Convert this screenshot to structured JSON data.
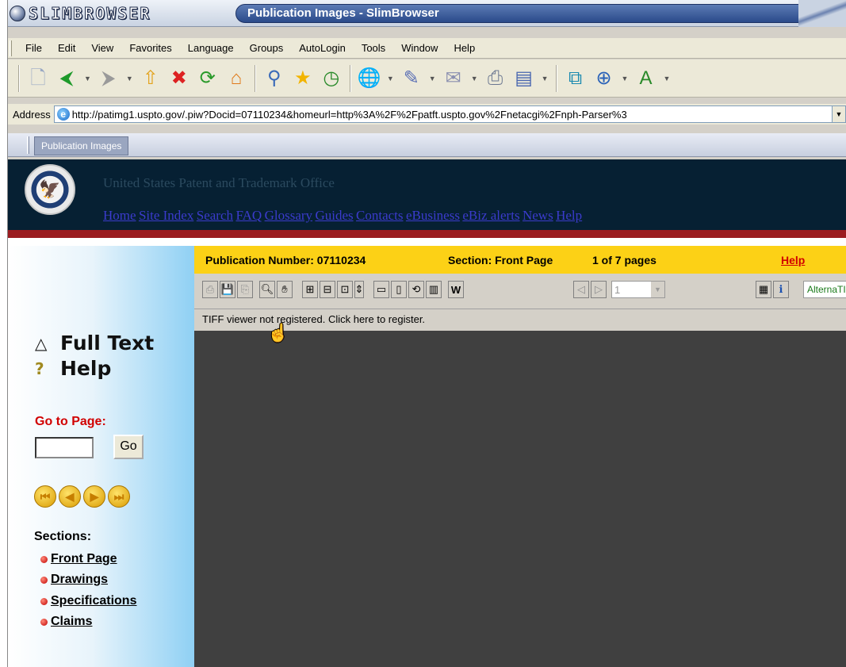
{
  "window": {
    "logo_text": "SLIMBROWSER",
    "title": "Publication Images - SlimBrowser"
  },
  "menu": [
    "File",
    "Edit",
    "View",
    "Favorites",
    "Language",
    "Groups",
    "AutoLogin",
    "Tools",
    "Window",
    "Help"
  ],
  "toolbar_icons": [
    "new-page-icon",
    "back-icon",
    "forward-icon",
    "up-folder-icon",
    "stop-icon",
    "refresh-icon",
    "home-icon",
    "search-icon",
    "favorites-icon",
    "history-icon",
    "internet-icon",
    "edit-icon",
    "mail-icon",
    "print-icon",
    "form-icon",
    "window-icon",
    "zoom-icon",
    "font-icon"
  ],
  "address": {
    "label": "Address",
    "url": "http://patimg1.uspto.gov/.piw?Docid=07110234&homeurl=http%3A%2F%2Fpatft.uspto.gov%2Fnetacgi%2Fnph-Parser%3"
  },
  "tabs": [
    {
      "label": "Publication Images"
    }
  ],
  "uspto": {
    "title": "United States Patent and Trademark Office",
    "nav": [
      "Home",
      "Site Index",
      "Search",
      "FAQ",
      "Glossary",
      "Guides",
      "Contacts",
      "eBusiness",
      "eBiz alerts",
      "News",
      "Help"
    ]
  },
  "sidebar": {
    "full_text": "Full Text",
    "help": "Help",
    "goto_label": "Go to Page:",
    "go_button": "Go",
    "goto_value": "",
    "sections_label": "Sections:",
    "sections": [
      "Front Page",
      "Drawings",
      "Specifications",
      "Claims"
    ]
  },
  "viewer": {
    "pub_number": "Publication Number: 07110234",
    "section": "Section: Front Page",
    "pages": "1 of 7 pages",
    "help": "Help",
    "page_select": "1",
    "alt_text": "AlternaTIFF",
    "tiff_note": "TIFF viewer not registered. Click here to register."
  },
  "colors": {
    "info_bar": "#fcd116",
    "header_bg": "#062033",
    "red_rule": "#9b1c20",
    "viewer_bg": "#404040"
  }
}
